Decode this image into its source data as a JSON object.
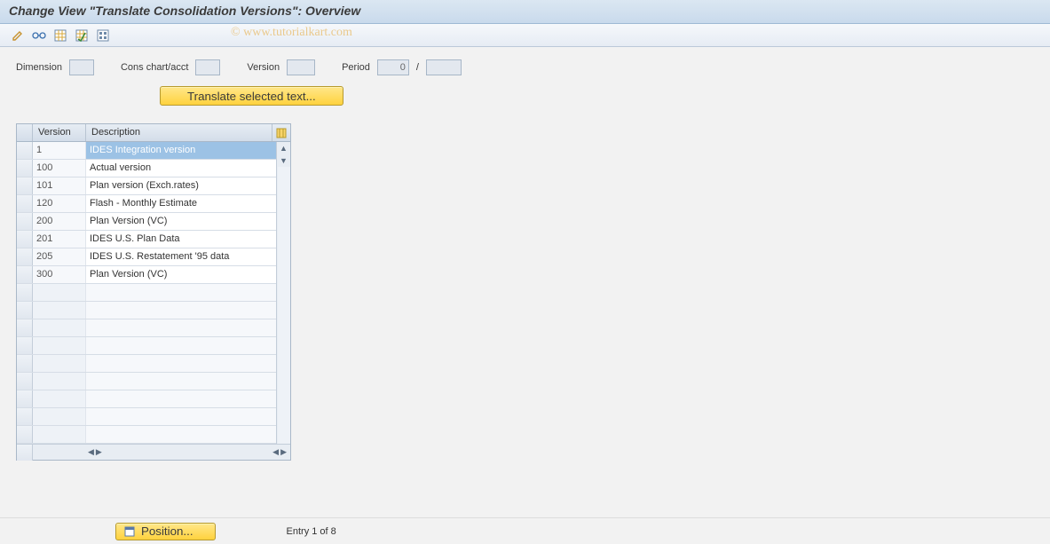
{
  "title": "Change View \"Translate Consolidation Versions\": Overview",
  "watermark": "© www.tutorialkart.com",
  "toolbar_icons": [
    "pencil",
    "glasses",
    "table",
    "table-check",
    "grid"
  ],
  "params": {
    "dimension_label": "Dimension",
    "dimension_value": "",
    "chart_label": "Cons chart/acct",
    "chart_value": "",
    "version_label": "Version",
    "version_value": "",
    "period_label": "Period",
    "period_value": "0",
    "period_sep": "/",
    "period2_value": ""
  },
  "translate_button": "Translate selected text...",
  "table": {
    "columns": {
      "version": "Version",
      "description": "Description"
    },
    "rows": [
      {
        "version": "1",
        "description": "IDES Integration version",
        "selected": true
      },
      {
        "version": "100",
        "description": "Actual version"
      },
      {
        "version": "101",
        "description": "Plan version (Exch.rates)"
      },
      {
        "version": "120",
        "description": "Flash - Monthly Estimate"
      },
      {
        "version": "200",
        "description": "Plan Version (VC)"
      },
      {
        "version": "201",
        "description": "IDES U.S. Plan Data"
      },
      {
        "version": "205",
        "description": "IDES U.S. Restatement '95 data"
      },
      {
        "version": "300",
        "description": "Plan Version (VC)"
      }
    ],
    "empty_rows": 9
  },
  "footer": {
    "position_button": "Position...",
    "entry_text": "Entry 1 of 8"
  }
}
